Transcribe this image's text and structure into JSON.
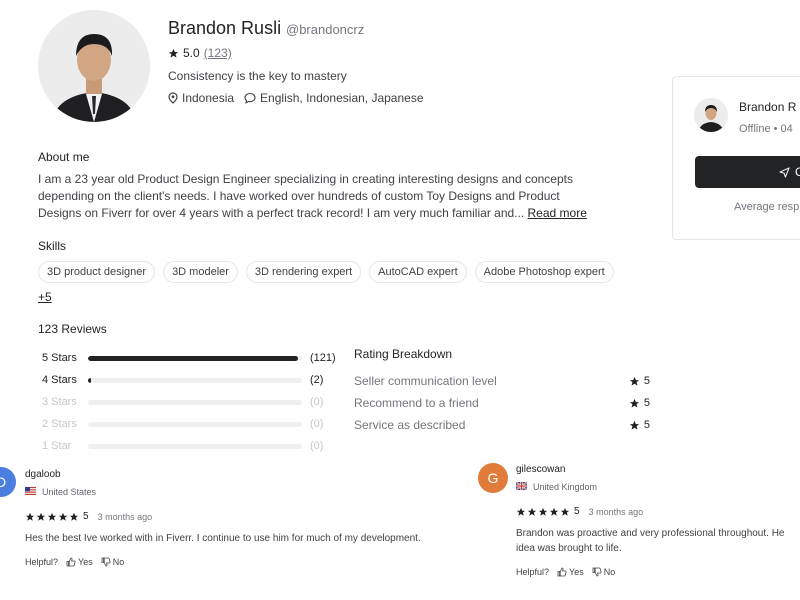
{
  "profile": {
    "name": "Brandon Rusli",
    "handle": "@brandoncrz",
    "rating": "5.0",
    "rating_count": "(123)",
    "tagline": "Consistency is the key to mastery",
    "location": "Indonesia",
    "languages": "English, Indonesian, Japanese"
  },
  "about": {
    "title": "About me",
    "text": "I am a 23 year old Product Design Engineer specializing in creating interesting designs and concepts depending on the client's needs. I have worked over hundreds of custom Toy Designs and Product Designs on Fiverr for over 4 years with a perfect track record! I am very much familiar and...",
    "read_more": "Read more"
  },
  "skills": {
    "title": "Skills",
    "items": [
      "3D product designer",
      "3D modeler",
      "3D rendering expert",
      "AutoCAD expert",
      "Adobe Photoshop expert"
    ],
    "more": "+5"
  },
  "reviews": {
    "title": "123 Reviews",
    "bars": [
      {
        "label": "5 Stars",
        "count": "(121)",
        "fraction": 0.98
      },
      {
        "label": "4 Stars",
        "count": "(2)",
        "fraction": 0.016
      },
      {
        "label": "3 Stars",
        "count": "(0)",
        "fraction": 0
      },
      {
        "label": "2 Stars",
        "count": "(0)",
        "fraction": 0
      },
      {
        "label": "1 Star",
        "count": "(0)",
        "fraction": 0
      }
    ],
    "breakdown_title": "Rating Breakdown",
    "breakdown": [
      {
        "label": "Seller communication level",
        "value": "5"
      },
      {
        "label": "Recommend to a friend",
        "value": "5"
      },
      {
        "label": "Service as described",
        "value": "5"
      }
    ],
    "list": [
      {
        "initial": "D",
        "avatar_color": "#4a7fe0",
        "user": "dgaloob",
        "country": "United States",
        "rating": "5",
        "time": "3 months ago",
        "text": "Hes the best Ive worked with in Fiverr. I continue to use him for much of my development.",
        "helpful": "Helpful?",
        "yes": "Yes",
        "no": "No"
      },
      {
        "initial": "G",
        "avatar_color": "#e07b39",
        "user": "gilescowan",
        "country": "United Kingdom",
        "rating": "5",
        "time": "3 months ago",
        "text_line1": "Brandon was proactive and very professional throughout. He",
        "text_line2": "idea was brought to life.",
        "helpful": "Helpful?",
        "yes": "Yes",
        "no": "No"
      }
    ]
  },
  "side_card": {
    "name": "Brandon R",
    "status": "Offline • 04",
    "contact_label": "C",
    "note": "Average resp"
  },
  "icons": {
    "star": "star-icon",
    "location": "location-pin-icon",
    "languages": "chat-bubble-icon",
    "thumbs_up": "thumbs-up-icon",
    "thumbs_down": "thumbs-down-icon",
    "send": "send-icon"
  }
}
